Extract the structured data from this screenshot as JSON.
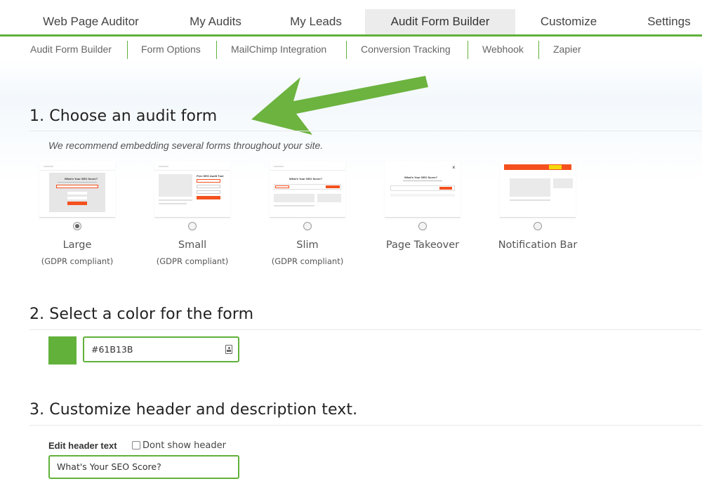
{
  "main_tabs": [
    {
      "label": "Web Page Auditor"
    },
    {
      "label": "My Audits"
    },
    {
      "label": "My Leads"
    },
    {
      "label": "Audit Form Builder",
      "active": true
    },
    {
      "label": "Customize"
    },
    {
      "label": "Settings"
    }
  ],
  "sub_nav": [
    {
      "label": "Audit Form Builder"
    },
    {
      "label": "Form Options"
    },
    {
      "label": "MailChimp Integration"
    },
    {
      "label": "Conversion Tracking"
    },
    {
      "label": "Webhook"
    },
    {
      "label": "Zapier"
    }
  ],
  "section1": {
    "title": "1. Choose an audit form",
    "recommend": "We recommend embedding several forms throughout your site.",
    "forms": [
      {
        "label": "Large",
        "sub": "(GDPR compliant)",
        "selected": true,
        "thumb_title": "What's Your SEO Score?"
      },
      {
        "label": "Small",
        "sub": "(GDPR compliant)",
        "selected": false,
        "thumb_title": "Free SEO Audit Tool"
      },
      {
        "label": "Slim",
        "sub": "(GDPR compliant)",
        "selected": false,
        "thumb_title": "What's Your SEO Score?"
      },
      {
        "label": "Page Takeover",
        "sub": "",
        "selected": false,
        "thumb_title": "What's Your SEO Score?"
      },
      {
        "label": "Notification Bar",
        "sub": "",
        "selected": false,
        "thumb_title": ""
      }
    ]
  },
  "section2": {
    "title": "2. Select a color for the form",
    "color_value": "#61B13B"
  },
  "section3": {
    "title": "3. Customize header and description text.",
    "edit_header_label": "Edit header text",
    "dont_show_label": "Dont show header",
    "header_value": "What's Your SEO Score?"
  },
  "colors": {
    "accent": "#61B13B",
    "orange": "#F4511E",
    "arrow": "#6CB33F"
  }
}
